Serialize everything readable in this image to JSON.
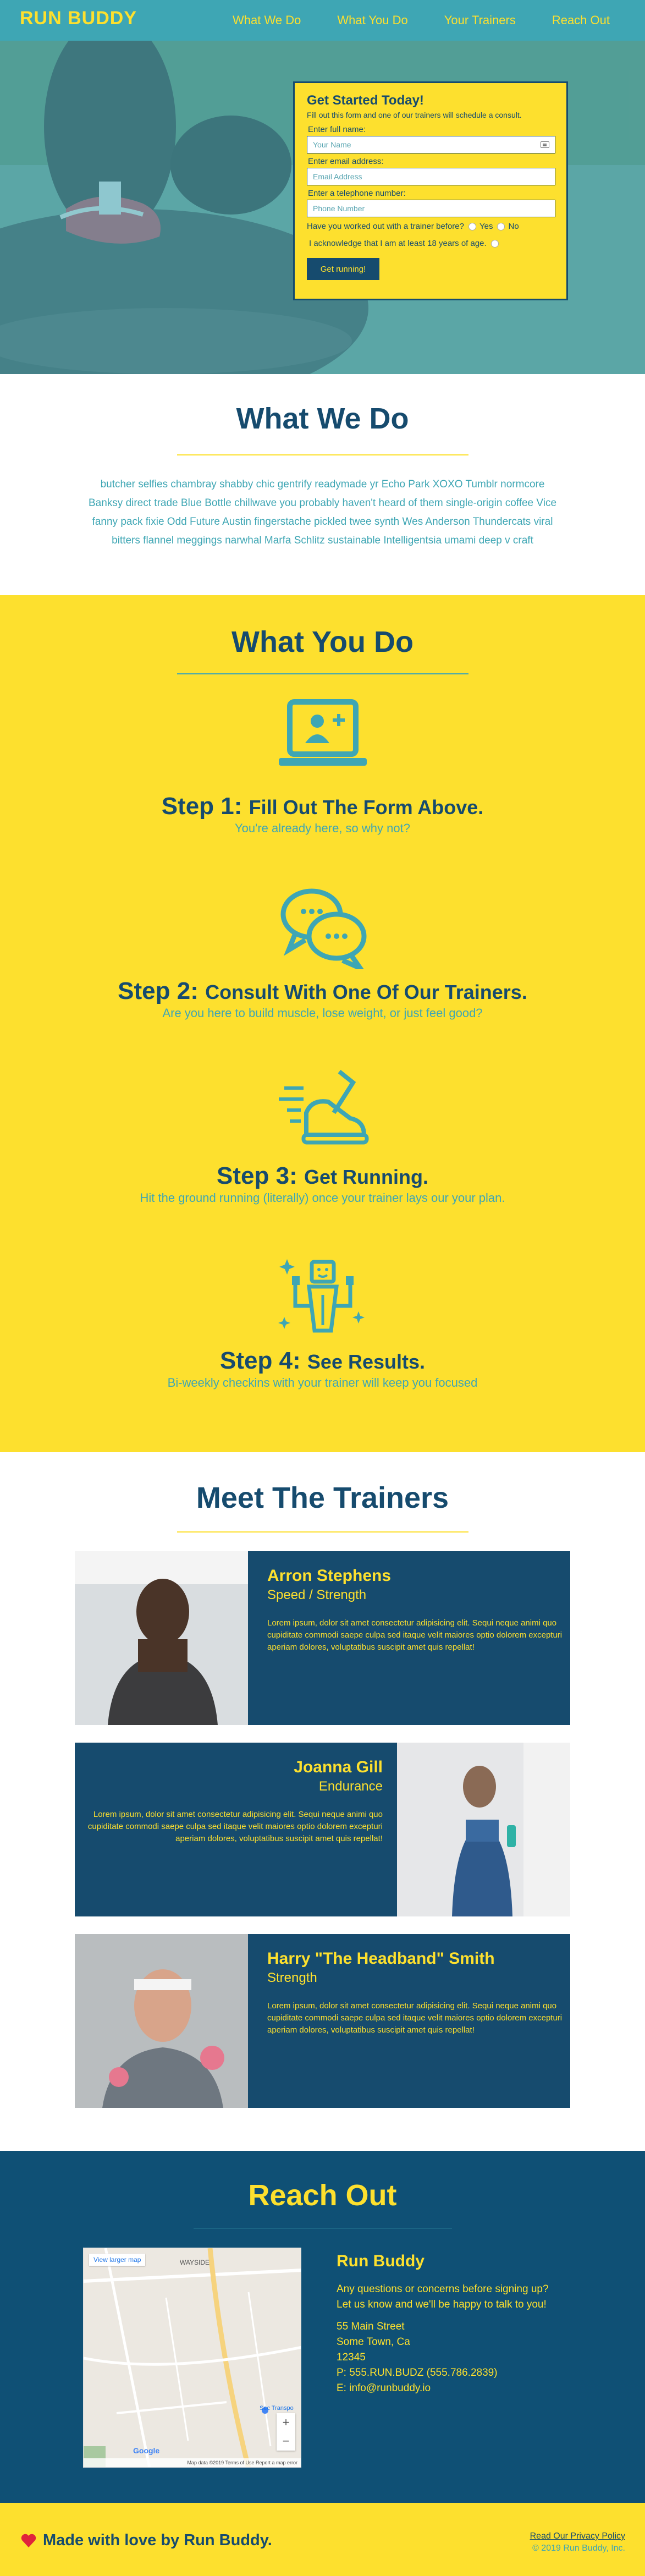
{
  "nav": {
    "brand": "RUN BUDDY",
    "links": [
      "What We Do",
      "What You Do",
      "Your Trainers",
      "Reach Out"
    ]
  },
  "form": {
    "title": "Get Started Today!",
    "subtitle": "Fill out this form and one of our trainers will schedule a consult.",
    "name_label": "Enter full name:",
    "name_placeholder": "Your Name",
    "email_label": "Enter email address:",
    "email_placeholder": "Email Address",
    "phone_label": "Enter a telephone number:",
    "phone_placeholder": "Phone Number",
    "worked_out_question": "Have you worked out with a trainer before?",
    "yes_label": "Yes",
    "no_label": "No",
    "age_ack": "I acknowledge that I am at least 18 years of age.",
    "submit_label": "Get running!"
  },
  "what_we_do": {
    "title": "What We Do",
    "text": "butcher selfies chambray shabby chic gentrify readymade yr Echo Park XOXO Tumblr normcore Banksy direct trade Blue Bottle chillwave you probably haven't heard of them single-origin coffee Vice fanny pack fixie Odd Future Austin fingerstache pickled twee synth Wes Anderson Thundercats viral bitters flannel meggings narwhal Marfa Schlitz sustainable Intelligentsia umami deep v craft"
  },
  "what_you_do": {
    "title": "What You Do",
    "steps": [
      {
        "num": "Step 1:",
        "title": "Fill Out The Form Above.",
        "sub": "You're already here, so why not?",
        "icon": "laptop-user-icon"
      },
      {
        "num": "Step 2:",
        "title": "Consult With One Of Our Trainers.",
        "sub": "Are you here to build muscle, lose weight, or just feel good?",
        "icon": "chat-bubbles-icon"
      },
      {
        "num": "Step 3:",
        "title": "Get Running.",
        "sub": "Hit the ground running (literally) once your trainer lays our your plan.",
        "icon": "running-shoe-icon"
      },
      {
        "num": "Step 4:",
        "title": "See Results.",
        "sub": "Bi-weekly checkins with your trainer will keep you focused",
        "icon": "strong-body-icon"
      }
    ]
  },
  "trainers": {
    "title": "Meet The Trainers",
    "list": [
      {
        "name": "Arron Stephens",
        "role": "Speed / Strength",
        "bio": "Lorem ipsum, dolor sit amet consectetur adipisicing elit. Sequi neque animi quo cupiditate commodi saepe culpa sed itaque velit maiores optio dolorem excepturi aperiam dolores, voluptatibus suscipit amet quis repellat!"
      },
      {
        "name": "Joanna Gill",
        "role": "Endurance",
        "bio": "Lorem ipsum, dolor sit amet consectetur adipisicing elit. Sequi neque animi quo cupiditate commodi saepe culpa sed itaque velit maiores optio dolorem excepturi aperiam dolores, voluptatibus suscipit amet quis repellat!"
      },
      {
        "name": "Harry \"The Headband\" Smith",
        "role": "Strength",
        "bio": "Lorem ipsum, dolor sit amet consectetur adipisicing elit. Sequi neque animi quo cupiditate commodi saepe culpa sed itaque velit maiores optio dolorem excepturi aperiam dolores, voluptatibus suscipit amet quis repellat!"
      }
    ]
  },
  "reach_out": {
    "title": "Reach Out",
    "map_link": "View larger map",
    "map_label": "WAYSIDE",
    "map_place": "Sec Transpo",
    "map_footer": "Map data ©2019  Terms of Use  Report a map error",
    "map_brand": "Google",
    "company": "Run Buddy",
    "message": "Any questions or concerns before signing up? Let us know and we'll be happy to talk to you!",
    "street": "55 Main Street",
    "city": "Some Town, Ca",
    "zip": "12345",
    "phone": "P: 555.RUN.BUDZ (555.786.2839)",
    "email_prefix": "E: ",
    "email": "info@runbuddy.io"
  },
  "footer": {
    "love": "Made with love by Run Buddy.",
    "policy": "Read Our Privacy Policy",
    "copyright": "© 2019 Run Buddy, Inc."
  },
  "colors": {
    "teal": "#3ea6b4",
    "yellow": "#fde02e",
    "navy": "#164b6e"
  }
}
